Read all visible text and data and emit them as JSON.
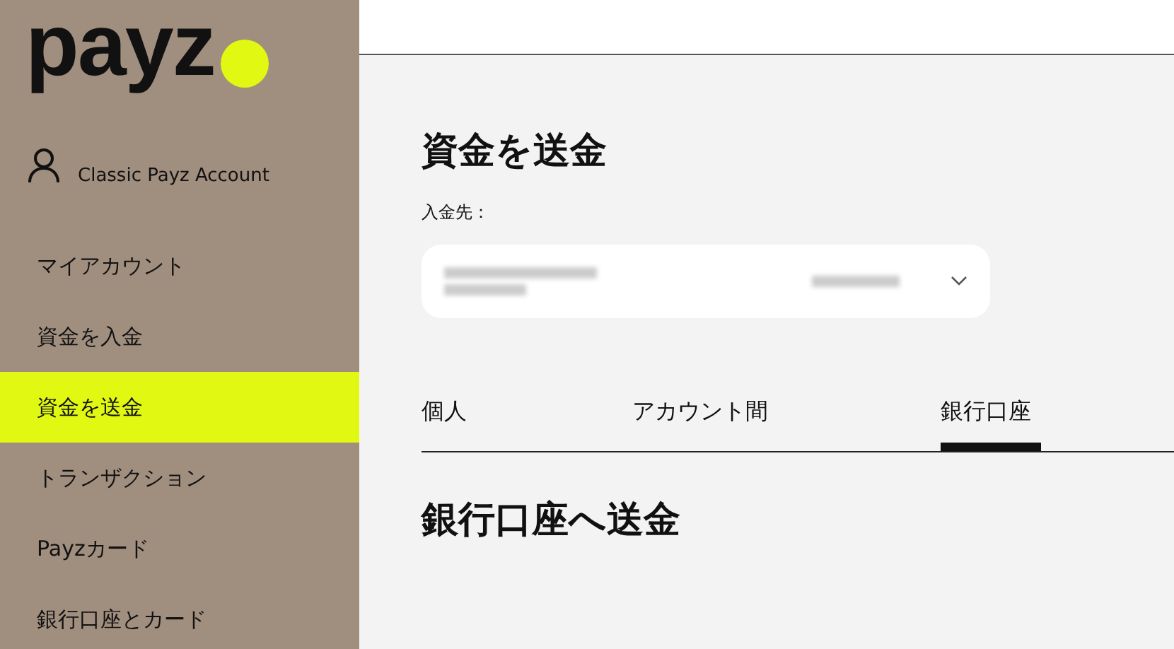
{
  "logo": {
    "text": "payz"
  },
  "account": {
    "name": "Classic Payz Account"
  },
  "nav": [
    {
      "label": "マイアカウント",
      "selected": false
    },
    {
      "label": "資金を入金",
      "selected": false
    },
    {
      "label": "資金を送金",
      "selected": true
    },
    {
      "label": "トランザクション",
      "selected": false
    },
    {
      "label": "Payzカード",
      "selected": false
    },
    {
      "label": "銀行口座とカード",
      "selected": false
    }
  ],
  "page": {
    "title": "資金を送金",
    "field_label": "入金先："
  },
  "tabs": [
    {
      "label": "個人",
      "selected": false
    },
    {
      "label": "アカウント間",
      "selected": false
    },
    {
      "label": "銀行口座",
      "selected": true
    }
  ],
  "section_title": "銀行口座へ送金"
}
